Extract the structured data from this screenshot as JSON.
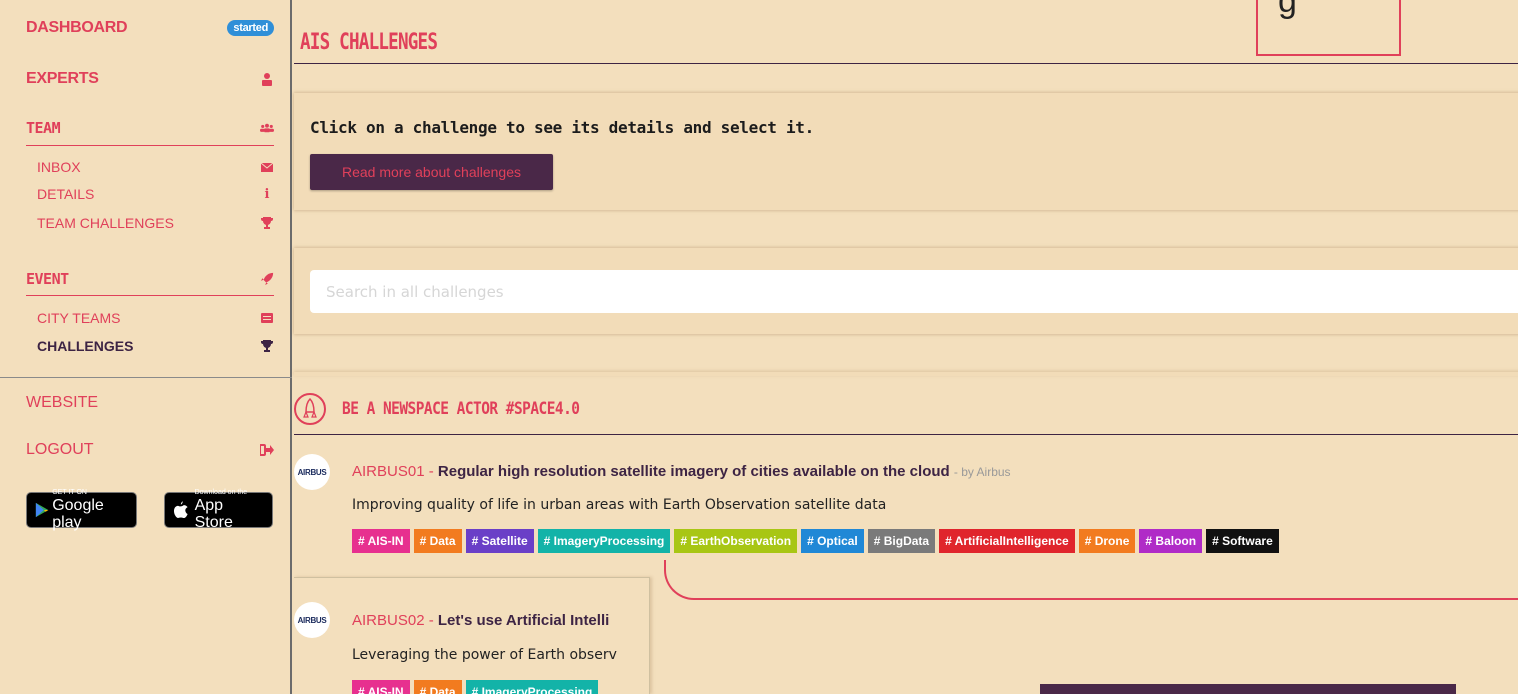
{
  "sidebar": {
    "dashboard": {
      "label": "DASHBOARD",
      "badge": "started"
    },
    "experts": {
      "label": "EXPERTS",
      "icon": "user-secret-icon"
    },
    "team": {
      "label": "TEAM",
      "icon": "users-icon"
    },
    "team_items": [
      {
        "label": "INBOX",
        "icon": "envelope-icon"
      },
      {
        "label": "DETAILS",
        "icon": "info-icon"
      },
      {
        "label": "TEAM CHALLENGES",
        "icon": "trophy-icon"
      }
    ],
    "event": {
      "label": "EVENT",
      "icon": "rocket-icon"
    },
    "event_items": [
      {
        "label": "CITY TEAMS",
        "icon": "list-icon"
      },
      {
        "label": "CHALLENGES",
        "icon": "trophy-icon"
      }
    ],
    "website": {
      "label": "WEBSITE"
    },
    "logout": {
      "label": "LOGOUT",
      "icon": "sign-out-icon"
    },
    "google_play": {
      "small": "GET IT ON",
      "big": "Google play"
    },
    "app_store": {
      "small": "Download on the",
      "big": "App Store"
    }
  },
  "main": {
    "title": "AIS CHALLENGES",
    "frame_glyph": "g",
    "intro": "Click on a challenge to see its details and select it.",
    "read_more": "Read more about challenges",
    "search_placeholder": "Search in all challenges",
    "category": {
      "title": "BE A NEWSPACE ACTOR #SPACE4.0",
      "icon": "rocket-outline-icon"
    },
    "challenges": [
      {
        "logo": "AIRBUS",
        "code": "AIRBUS01",
        "title": "Regular high resolution satellite imagery of cities available on the cloud",
        "by": "- by Airbus",
        "description": "Improving quality of life in urban areas with Earth Observation satellite data",
        "tags": [
          {
            "label": "# AIS-IN",
            "color": "#e7308f"
          },
          {
            "label": "# Data",
            "color": "#f27b1f"
          },
          {
            "label": "# Satellite",
            "color": "#6a3fc7"
          },
          {
            "label": "# ImageryProcessing",
            "color": "#13b3a8"
          },
          {
            "label": "# EarthObservation",
            "color": "#a8c614"
          },
          {
            "label": "# Optical",
            "color": "#2088d6"
          },
          {
            "label": "# BigData",
            "color": "#7a7a7a"
          },
          {
            "label": "# ArtificialIntelligence",
            "color": "#e0252c"
          },
          {
            "label": "# Drone",
            "color": "#f27b1f"
          },
          {
            "label": "# Baloon",
            "color": "#b02bc7"
          },
          {
            "label": "# Software",
            "color": "#111111"
          }
        ]
      },
      {
        "logo": "AIRBUS",
        "code": "AIRBUS02",
        "title": "Let's use Artificial Intelli",
        "by": "",
        "description": "Leveraging the power of Earth observ",
        "tags": [
          {
            "label": "# AIS-IN",
            "color": "#e7308f"
          },
          {
            "label": "# Data",
            "color": "#f27b1f"
          },
          {
            "label": "# ImageryProcessing",
            "color": "#13b3a8"
          }
        ]
      }
    ]
  }
}
